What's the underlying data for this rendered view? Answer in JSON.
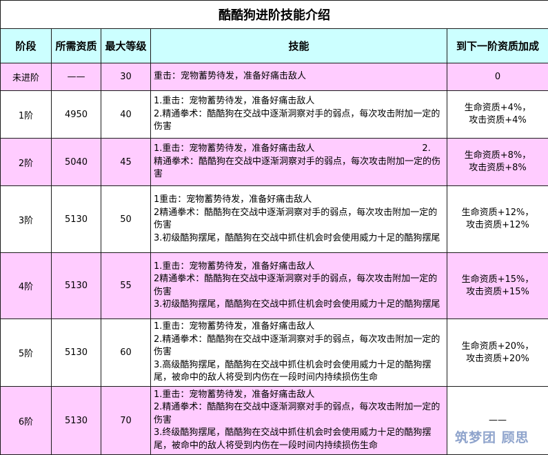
{
  "title": "酷酷狗进阶技能介绍",
  "headers": [
    "阶段",
    "所需资质",
    "最大等级",
    "技能",
    "到下一阶资质加成"
  ],
  "rows": [
    {
      "stage": "未进阶",
      "aptitude": "——",
      "max_level": "30",
      "skills": [
        "重击：宠物蓄势待发，准备好痛击敌人"
      ],
      "bonus": [
        "0"
      ]
    },
    {
      "stage": "1阶",
      "aptitude": "4950",
      "max_level": "40",
      "skills": [
        "1.重击：宠物蓄势待发，准备好痛击敌人",
        "2.精通拳术：酷酷狗在交战中逐渐洞察对手的弱点，每次攻击附加一定的伤害"
      ],
      "bonus": [
        "生命资质+4%，",
        "攻击资质+4%"
      ]
    },
    {
      "stage": "2阶",
      "aptitude": "5040",
      "max_level": "45",
      "skills": [
        "1.重击：宠物蓄势待发，准备好痛击敌人　　　　　　　　　　　　2.",
        "精通拳术：酷酷狗在交战中逐渐洞察对手的弱点，每次攻击附加一定的伤害"
      ],
      "bonus": [
        "生命资质+8%，",
        "攻击资质+8%"
      ]
    },
    {
      "stage": "3阶",
      "aptitude": "5130",
      "max_level": "50",
      "skills": [
        "1重击：宠物蓄势待发，准备好痛击敌人",
        "2精通拳术：酷酷狗在交战中逐渐洞察对手的弱点，每次攻击附加一定的伤害",
        "3.初级酷狗摆尾，酷酷狗在交战中抓住机会时会使用威力十足的酷狗摆尾"
      ],
      "bonus": [
        "生命资质+12%，",
        "攻击资质+12%"
      ]
    },
    {
      "stage": "4阶",
      "aptitude": "5130",
      "max_level": "55",
      "skills": [
        "1.重击：宠物蓄势待发，准备好痛击敌人",
        "2精通拳术：酷酷狗在交战中逐渐洞察对手的弱点，每次攻击附加一定的伤害",
        "3.初级酷狗摆尾，酷酷狗在交战中抓住机会时会使用威力十足的酷狗摆尾"
      ],
      "bonus": [
        "生命资质+15%，",
        "攻击资质+15%"
      ]
    },
    {
      "stage": "5阶",
      "aptitude": "5130",
      "max_level": "60",
      "skills": [
        "1.重击：宠物蓄势待发，准备好痛击敌人",
        "2.精通拳术：酷酷狗在交战中逐渐洞察对手的弱点，每次攻击附加一定的伤害",
        "3.高级酷狗摆尾，酷酷狗在交战中抓住机会时会使用威力十足的酷狗摆尾，被命中的敌人将受到内伤在一段时间内持续损伤生命"
      ],
      "bonus": [
        "生命资质+20%，",
        "攻击资质+20%"
      ]
    },
    {
      "stage": "6阶",
      "aptitude": "5130",
      "max_level": "70",
      "skills": [
        "1.重击：宠物蓄势待发，准备好痛击敌人",
        "2.精通拳术：酷酷狗在交战中逐渐洞察对手的弱点，每次攻击附加一定的伤害",
        "3.终级酷狗摆尾，酷酷狗在交战中抓住机会时会使用威力十足的酷狗摆尾，被命中的敌人将受到内伤在一段时间内持续损伤生命"
      ],
      "bonus": [
        "——"
      ]
    }
  ],
  "watermark": "筑梦团 顾思",
  "colors": {
    "header_bg": "#ccffff",
    "pink_row_bg": "#ffccff",
    "white_row_bg": "#ffffff",
    "watermark": "#8fa4cc"
  }
}
